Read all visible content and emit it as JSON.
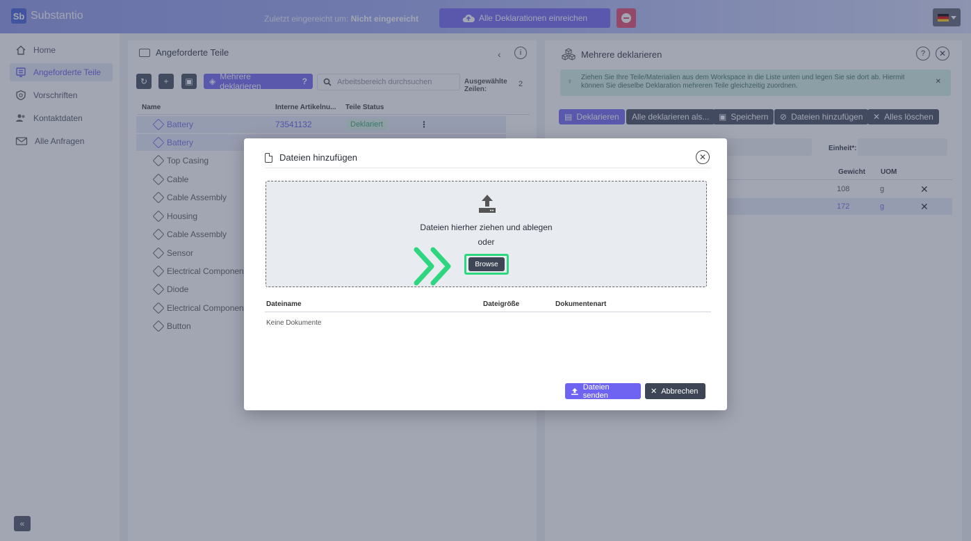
{
  "app": {
    "logo_mark": "Sb",
    "name": "Substantio"
  },
  "header": {
    "submitted_label": "Zuletzt eingereicht um:",
    "submitted_value": "Nicht eingereicht",
    "submit_all_label": "Alle Deklarationen einreichen"
  },
  "sidebar": {
    "items": [
      {
        "label": "Home",
        "icon": "home-icon"
      },
      {
        "label": "Angeforderte Teile",
        "icon": "parts-icon"
      },
      {
        "label": "Vorschriften",
        "icon": "shield-icon"
      },
      {
        "label": "Kontaktdaten",
        "icon": "contacts-icon"
      },
      {
        "label": "Alle Anfragen",
        "icon": "mail-icon"
      }
    ],
    "collapse_label": "«"
  },
  "parts": {
    "title": "Angeforderte Teile",
    "multi_declare_label": "Mehrere deklarieren",
    "search_placeholder": "Arbeitsbereich durchsuchen",
    "selected_label_1": "Ausgewählte",
    "selected_label_2": "Zeilen:",
    "selected_count": "2",
    "columns": [
      "Name",
      "Interne Artikelnu...",
      "Teile Status"
    ],
    "rows": [
      {
        "name": "Battery",
        "id": "73541132",
        "status": "Deklariert"
      },
      {
        "name": "Battery"
      },
      {
        "name": "Top Casing"
      },
      {
        "name": "Cable"
      },
      {
        "name": "Cable Assembly"
      },
      {
        "name": "Housing"
      },
      {
        "name": "Cable Assembly"
      },
      {
        "name": "Sensor"
      },
      {
        "name": "Electrical Component"
      },
      {
        "name": "Diode"
      },
      {
        "name": "Electrical Component"
      },
      {
        "name": "Button"
      }
    ]
  },
  "multi": {
    "title": "Mehrere deklarieren",
    "note_line1": "Ziehen Sie Ihre Teile/Materialien aus dem Workspace in die Liste unten und legen Sie sie dort ab. Hiermit",
    "note_line2": "können Sie dieselbe Deklaration mehreren Teile gleichzeitig zuordnen.",
    "buttons": {
      "declare": "Deklarieren",
      "declare_all": "Alle deklarieren als...",
      "save": "Speichern",
      "add_files": "Dateien hinzufügen",
      "clear_all": "Alles löschen"
    },
    "unit_label": "Einheit*:",
    "columns": [
      "Gewicht",
      "UOM"
    ],
    "rows": [
      {
        "weight": "108",
        "uom": "g"
      },
      {
        "weight": "172",
        "uom": "g"
      }
    ]
  },
  "modal": {
    "title": "Dateien hinzufügen",
    "drop_text": "Dateien hierher ziehen und ablegen",
    "or_text": "oder",
    "browse_label": "Browse",
    "columns": [
      "Dateiname",
      "Dateigröße",
      "Dokumentenart"
    ],
    "empty_text": "Keine Dokumente",
    "send_label": "Dateien senden",
    "cancel_label": "Abbrechen"
  },
  "colors": {
    "accent": "#6f63f2",
    "dark_button": "#3e4656",
    "highlight": "#2ed67f",
    "success": "#2ea36a"
  }
}
